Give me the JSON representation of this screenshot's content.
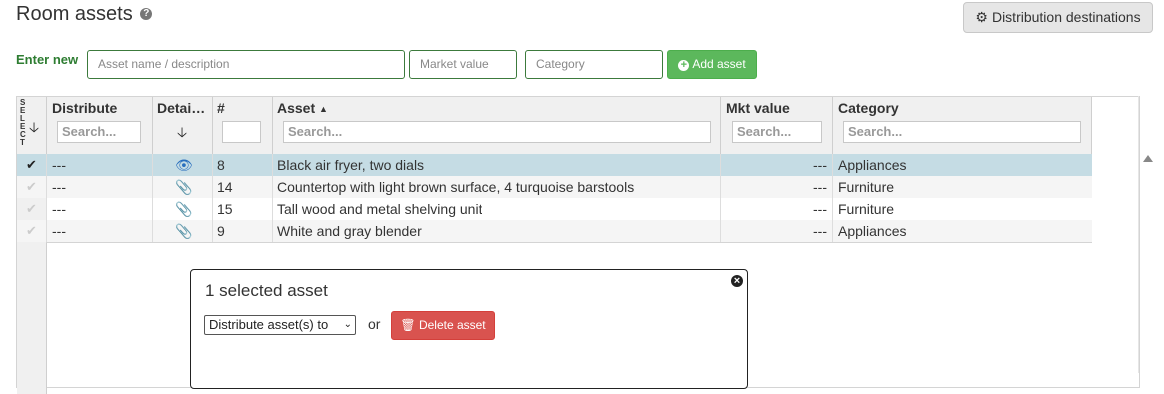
{
  "header": {
    "title": "Room assets",
    "help_icon": "?",
    "dist_button": "Distribution destinations"
  },
  "enter_new": {
    "label": "Enter new",
    "asset_placeholder": "Asset name / description",
    "value_placeholder": "Market value",
    "category_placeholder": "Category",
    "add_label": "Add asset"
  },
  "table": {
    "select_header": "SELECT",
    "columns": {
      "distribute": "Distribute",
      "details": "Detai…",
      "number": "#",
      "asset": "Asset",
      "mkt_value": "Mkt value",
      "category": "Category"
    },
    "search_placeholder": "Search...",
    "rows": [
      {
        "selected": true,
        "distribute": "---",
        "details_icon": "eye-icon",
        "number": "8",
        "asset": "Black air fryer, two dials",
        "mkt_value": "---",
        "category": "Appliances"
      },
      {
        "selected": false,
        "distribute": "---",
        "details_icon": "paperclip-icon",
        "number": "14",
        "asset": "Countertop with light brown surface, 4 turquoise barstools",
        "mkt_value": "---",
        "category": "Furniture"
      },
      {
        "selected": false,
        "distribute": "---",
        "details_icon": "paperclip-icon",
        "number": "15",
        "asset": "Tall wood and metal shelving unit",
        "mkt_value": "---",
        "category": "Furniture"
      },
      {
        "selected": false,
        "distribute": "---",
        "details_icon": "paperclip-icon",
        "number": "9",
        "asset": "White and gray blender",
        "mkt_value": "---",
        "category": "Appliances"
      }
    ]
  },
  "panel": {
    "title": "1 selected asset",
    "select_value": "Distribute asset(s) to",
    "or_text": "or",
    "delete_label": "Delete asset"
  },
  "colors": {
    "selected_row": "#c5dce4",
    "add_green": "#5cb85c",
    "delete_red": "#d9534f",
    "icon_blue": "#2a6fbe"
  }
}
